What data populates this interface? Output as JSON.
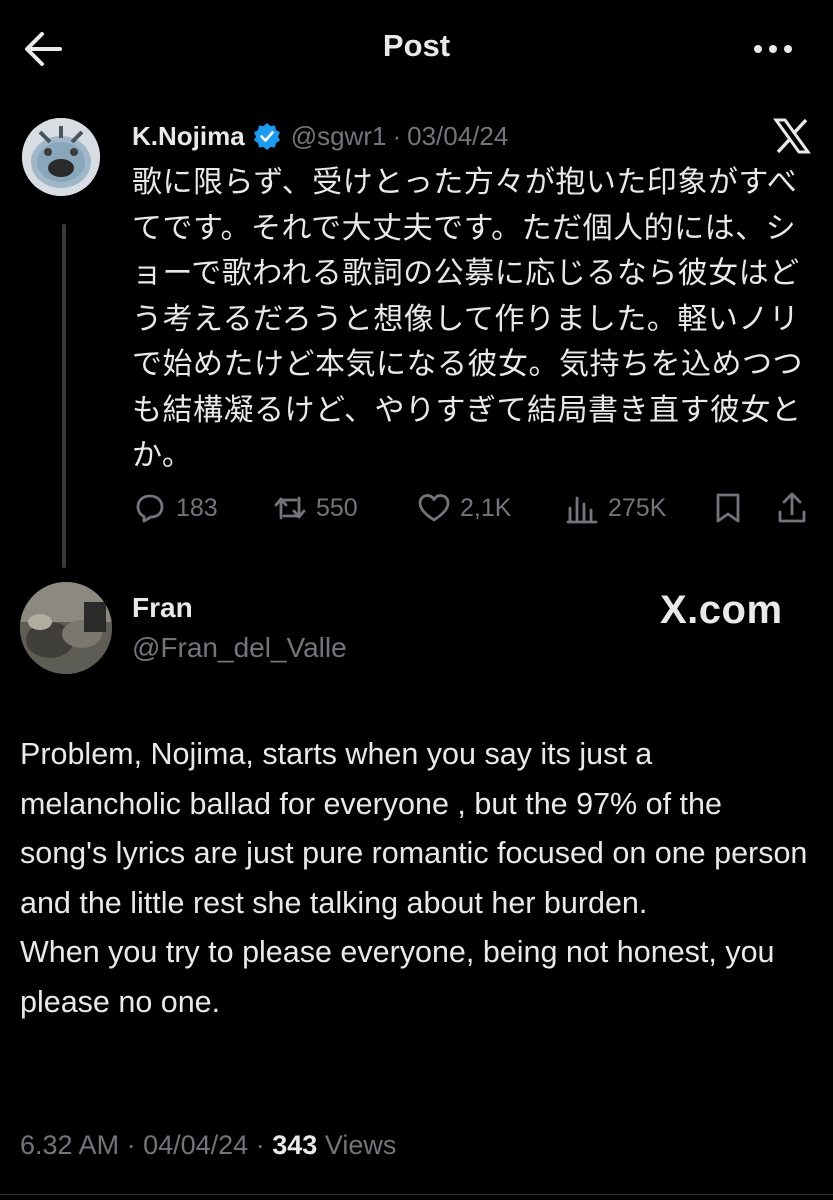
{
  "header": {
    "title": "Post"
  },
  "quoted": {
    "name": "K.Nojima",
    "handle": "@sgwr1",
    "sep": "·",
    "date": "03/04/24",
    "text": "歌に限らず、受けとった方々が抱いた印象がすべてです。それで大丈夫です。ただ個人的には、ショーで歌われる歌詞の公募に応じるなら彼女はどう考えるだろうと想像して作りました。軽いノリで始めたけど本気になる彼女。気持ちを込めつつも結構凝るけど、やりすぎて結局書き直す彼女とか。",
    "replies": "183",
    "reposts": "550",
    "likes": "2,1K",
    "views": "275K"
  },
  "post": {
    "name": "Fran",
    "handle": "@Fran_del_Valle",
    "watermark": "X.com",
    "text": "Problem, Nojima, starts when you say its just a melancholic ballad for everyone , but the 97% of the song's lyrics are just pure romantic focused on one person and the little rest she talking about her burden.\nWhen you try to please everyone, being not honest, you please no one.",
    "time": "6.32 AM",
    "sep1": "·",
    "date": "04/04/24",
    "sep2": "·",
    "views_count": "343",
    "views_label": "Views"
  },
  "icons": {
    "back": "arrow-left-icon",
    "more": "more-horizontal-icon",
    "verified": "verified-badge-icon",
    "x_logo": "x-logo-icon",
    "reply": "reply-icon",
    "repost": "repost-icon",
    "like": "heart-icon",
    "views": "views-chart-icon",
    "bookmark": "bookmark-icon",
    "share": "share-icon"
  },
  "colors": {
    "background": "#000000",
    "text": "#e7e9ea",
    "muted": "#71767b",
    "verified": "#1d9bf0"
  }
}
